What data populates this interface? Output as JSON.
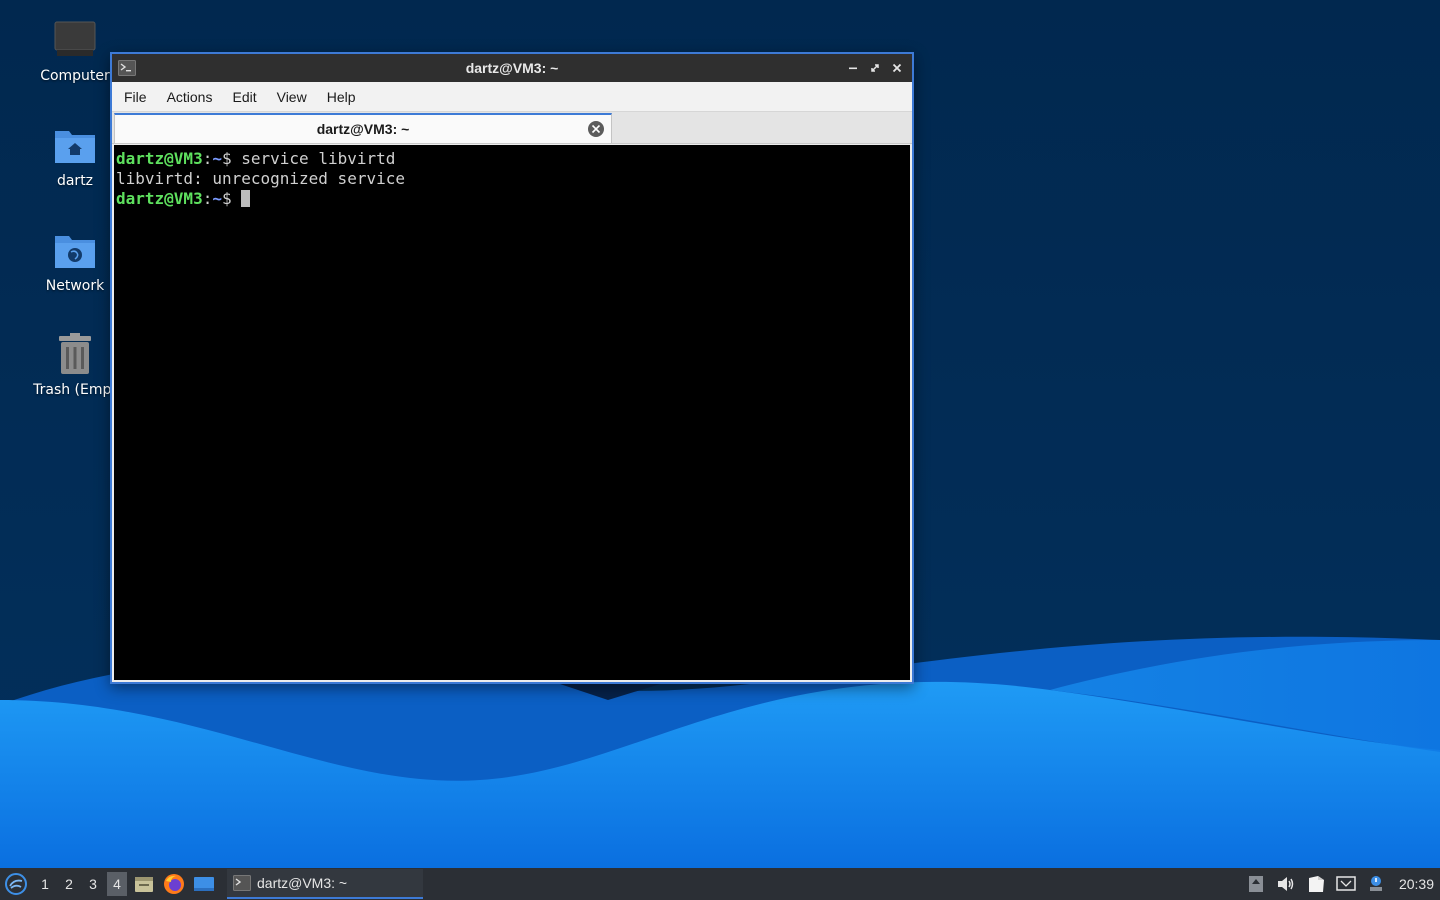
{
  "desktop": {
    "icons": [
      {
        "label": "Computer"
      },
      {
        "label": "dartz"
      },
      {
        "label": "Network"
      },
      {
        "label": "Trash (Empt"
      }
    ]
  },
  "window": {
    "title": "dartz@VM3: ~",
    "menu": [
      "File",
      "Actions",
      "Edit",
      "View",
      "Help"
    ],
    "tab": {
      "label": "dartz@VM3: ~"
    }
  },
  "terminal": {
    "line1": {
      "user": "dartz@VM3",
      "sep": ":",
      "path": "~",
      "symbol": "$ ",
      "command": "service libvirtd"
    },
    "line2": {
      "output": "libvirtd: unrecognized service"
    },
    "line3": {
      "user": "dartz@VM3",
      "sep": ":",
      "path": "~",
      "symbol": "$ "
    }
  },
  "taskbar": {
    "workspaces": [
      "1",
      "2",
      "3",
      "4"
    ],
    "active_workspace": "4",
    "task_label": "dartz@VM3: ~",
    "clock": "20:39"
  },
  "colors": {
    "accent": "#3d7ad6",
    "prompt_user": "#5ee05e",
    "prompt_path": "#7b9bff",
    "wallpaper_dark": "#022a52",
    "wallpaper_light": "#1a93f0"
  }
}
